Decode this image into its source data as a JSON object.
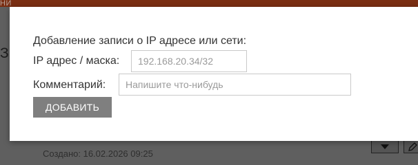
{
  "background": {
    "topbar_text": "НИ",
    "side_letter": "З",
    "created_text": "Создано: 16.02.2026 09:25",
    "dropdown_icon": "caret-down-icon",
    "edit_icon": "pencil-icon"
  },
  "modal": {
    "heading": "Добавление записи о IP адресе или сети:",
    "ip_label": "IP адрес / маска:",
    "ip_placeholder": "192.168.20.34/32",
    "comment_label": "Комментарий:",
    "comment_placeholder": "Напишите что-нибудь",
    "add_button_label": "ДОБАВИТЬ"
  },
  "colors": {
    "overlay": "#5f5f5f",
    "topbar": "#7a2e12",
    "button": "#7f7f7f",
    "text": "#333333"
  }
}
